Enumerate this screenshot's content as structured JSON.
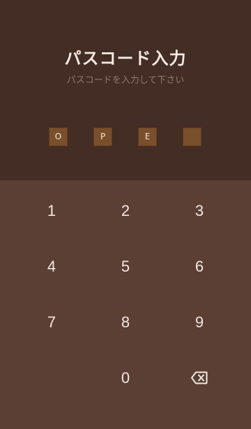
{
  "header": {
    "title": "パスコード入力",
    "subtitle": "パスコードを入力して下さい"
  },
  "pin": {
    "digits": [
      "O",
      "P",
      "E",
      ""
    ]
  },
  "keypad": {
    "keys": [
      "1",
      "2",
      "3",
      "4",
      "5",
      "6",
      "7",
      "8",
      "9",
      "0"
    ],
    "backspace_icon": "backspace-icon"
  },
  "colors": {
    "header_bg": "#432d24",
    "keypad_bg": "#5b3f34",
    "pin_box": "#7a4f2c",
    "title_text": "#f4ebe4",
    "subtitle_text": "#8f7a6e"
  }
}
